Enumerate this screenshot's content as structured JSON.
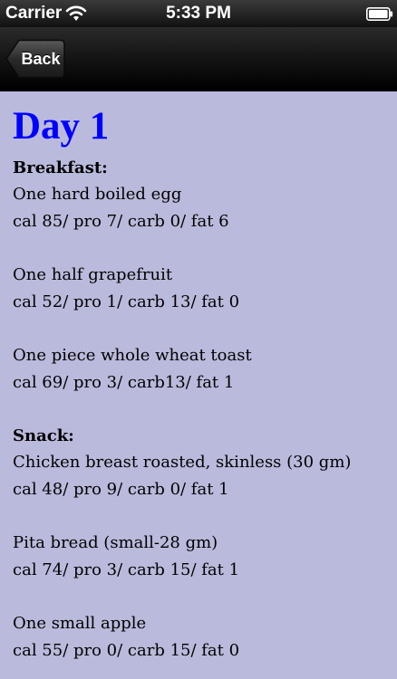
{
  "status": {
    "carrier": "Carrier",
    "time": "5:33 PM"
  },
  "nav": {
    "back_label": "Back"
  },
  "content": {
    "day_title": "Day 1",
    "background_color": "#babadc",
    "title_color": "#0000ff",
    "sections": [
      {
        "heading": "Breakfast:",
        "items": [
          {
            "name": "One hard boiled egg",
            "macros": "cal 85/ pro 7/ carb 0/ fat 6"
          },
          {
            "name": "One half grapefruit",
            "macros": "cal 52/ pro 1/ carb 13/ fat 0"
          },
          {
            "name": "One piece whole wheat toast",
            "macros": "cal 69/ pro 3/ carb13/ fat 1"
          }
        ]
      },
      {
        "heading": "Snack:",
        "items": [
          {
            "name": "Chicken breast roasted, skinless (30 gm)",
            "macros": "cal 48/ pro 9/ carb 0/ fat 1"
          },
          {
            "name": "Pita bread (small-28 gm)",
            "macros": "cal 74/ pro 3/ carb 15/ fat 1"
          },
          {
            "name": "One small apple",
            "macros": "cal 55/ pro 0/ carb 15/ fat 0"
          }
        ]
      }
    ]
  },
  "icons": {
    "wifi": "wifi-icon",
    "battery": "battery-icon"
  }
}
